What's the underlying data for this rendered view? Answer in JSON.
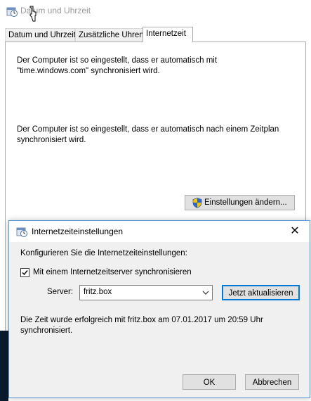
{
  "main_window": {
    "title": "Datum und Uhrzeit",
    "tabs": [
      {
        "label": "Datum und Uhrzeit"
      },
      {
        "label": "Zusätzliche Uhren"
      },
      {
        "label": "Internetzeit"
      }
    ],
    "active_tab": "Internetzeit",
    "sync_text": "Der Computer ist so eingestellt, dass er automatisch mit\n\"time.windows.com\" synchronisiert wird.",
    "schedule_text": "Der Computer ist so eingestellt, dass er automatisch nach einem Zeitplan\nsynchronisiert wird.",
    "settings_button": "Einstellungen ändern..."
  },
  "dialog": {
    "title": "Internetzeiteinstellungen",
    "heading": "Konfigurieren Sie die Internetzeiteinstellungen:",
    "checkbox_label": "Mit einem Internetzeitserver synchronisieren",
    "checkbox_checked": true,
    "server_label": "Server:",
    "server_value": "fritz.box",
    "update_button": "Jetzt aktualisieren",
    "status": "Die Zeit wurde erfolgreich mit fritz.box am 07.01.2017 um 20:59 Uhr\nsynchronisiert.",
    "ok_button": "OK",
    "cancel_button": "Abbrechen",
    "close_glyph": "✕"
  },
  "colors": {
    "accent": "#0078d7",
    "dialog_border": "#5b9bd5",
    "button_face": "#e1e1e1",
    "dialog_bg": "#f0f0f0"
  },
  "icons": [
    "clock-icon",
    "shield-icon",
    "close-icon",
    "chevron-down-icon",
    "checkmark-icon",
    "mouse-cursor-icon"
  ]
}
